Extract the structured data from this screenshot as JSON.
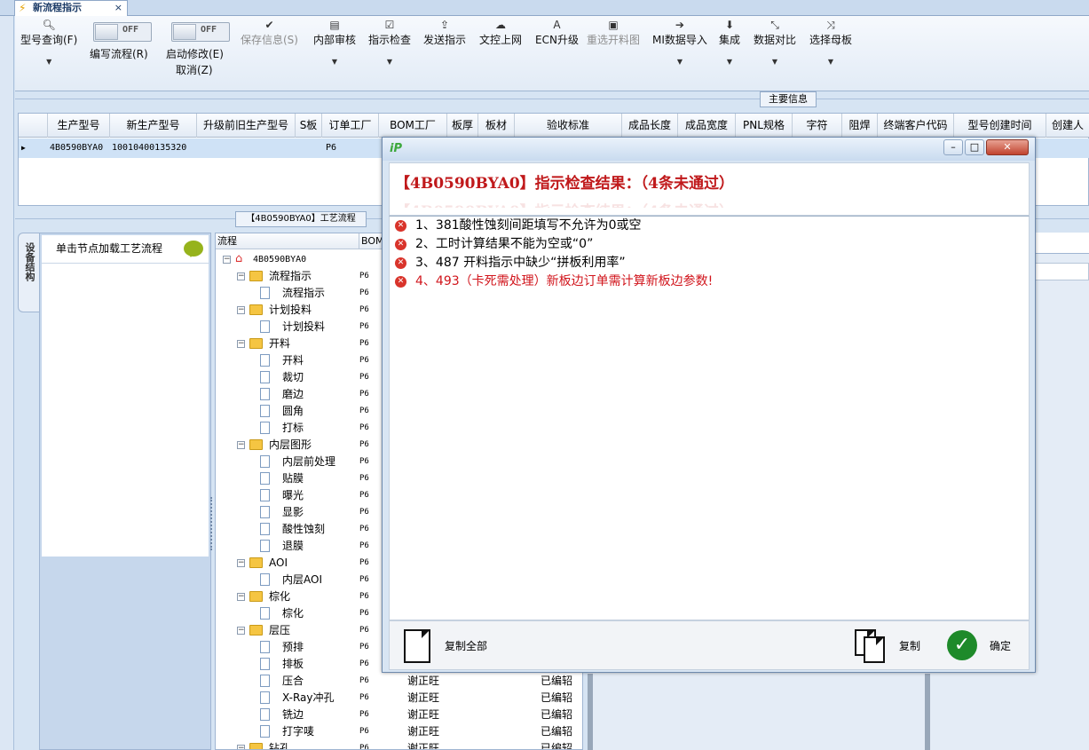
{
  "tab": {
    "title": "新流程指示",
    "close": "×"
  },
  "ribbon": {
    "model_query": "型号查询(F)",
    "write_flow": "编写流程(R)",
    "write_flow_toggle": "OFF",
    "auto_modify": "启动修改(E)",
    "auto_modify_toggle": "OFF",
    "cancel": "取消(Z)",
    "save_info": "保存信息(S)",
    "internal_review": "内部审核",
    "instr_check": "指示检查",
    "send_instr": "发送指示",
    "upload": "文控上网",
    "ecn_upgrade": "ECN升级",
    "reselect_cut": "重选开料图",
    "mi_import": "MI数据导入",
    "integrate": "集成",
    "data_compare": "数据对比",
    "select_mother": "选择母板"
  },
  "section_main": "主要信息",
  "grid": {
    "headers": [
      "生产型号",
      "新生产型号",
      "升级前旧生产型号",
      "S板",
      "订单工厂",
      "BOM工厂",
      "板厚",
      "板材",
      "验收标准",
      "成品长度",
      "成品宽度",
      "PNL规格",
      "字符",
      "阻焊",
      "终端客户代码",
      "型号创建时间",
      "创建人"
    ],
    "row": {
      "model": "4B0590BYA0",
      "new_model": "10010400135320",
      "bom": "P6"
    }
  },
  "section_flow": "【4B0590BYA0】工艺流程",
  "side": {
    "vtab": "设备结构",
    "head": "单击节点加载工艺流程"
  },
  "tree": {
    "col_flow": "流程",
    "col_bom": "BOM_",
    "rows": [
      {
        "label": "4B0590BYA0",
        "bom": "",
        "p2": "",
        "p3": ""
      },
      {
        "label": "流程指示",
        "bom": "P6",
        "p2": "",
        "p3": ""
      },
      {
        "label": "流程指示",
        "bom": "P6",
        "p2": "",
        "p3": ""
      },
      {
        "label": "计划投料",
        "bom": "P6",
        "p2": "",
        "p3": ""
      },
      {
        "label": "计划投料",
        "bom": "P6",
        "p2": "",
        "p3": ""
      },
      {
        "label": "开料",
        "bom": "P6",
        "p2": "",
        "p3": ""
      },
      {
        "label": "开料",
        "bom": "P6",
        "p2": "",
        "p3": ""
      },
      {
        "label": "裁切",
        "bom": "P6",
        "p2": "",
        "p3": ""
      },
      {
        "label": "磨边",
        "bom": "P6",
        "p2": "",
        "p3": ""
      },
      {
        "label": "圆角",
        "bom": "P6",
        "p2": "",
        "p3": ""
      },
      {
        "label": "打标",
        "bom": "P6",
        "p2": "",
        "p3": ""
      },
      {
        "label": "内层图形",
        "bom": "P6",
        "p2": "",
        "p3": ""
      },
      {
        "label": "内层前处理",
        "bom": "P6",
        "p2": "",
        "p3": ""
      },
      {
        "label": "贴膜",
        "bom": "P6",
        "p2": "",
        "p3": ""
      },
      {
        "label": "曝光",
        "bom": "P6",
        "p2": "",
        "p3": ""
      },
      {
        "label": "显影",
        "bom": "P6",
        "p2": "",
        "p3": ""
      },
      {
        "label": "酸性蚀刻",
        "bom": "P6",
        "p2": "",
        "p3": ""
      },
      {
        "label": "退膜",
        "bom": "P6",
        "p2": "",
        "p3": ""
      },
      {
        "label": "AOI",
        "bom": "P6",
        "p2": "",
        "p3": ""
      },
      {
        "label": "内层AOI",
        "bom": "P6",
        "p2": "",
        "p3": ""
      },
      {
        "label": "棕化",
        "bom": "P6",
        "p2": "",
        "p3": ""
      },
      {
        "label": "棕化",
        "bom": "P6",
        "p2": "",
        "p3": ""
      },
      {
        "label": "层压",
        "bom": "P6",
        "p2": "",
        "p3": ""
      },
      {
        "label": "预排",
        "bom": "P6",
        "p2": "",
        "p3": ""
      },
      {
        "label": "排板",
        "bom": "P6",
        "p2": "",
        "p3": ""
      },
      {
        "label": "压合",
        "bom": "P6",
        "p2": "谢正旺",
        "p3": "已编轺"
      },
      {
        "label": "X-Ray冲孔",
        "bom": "P6",
        "p2": "谢正旺",
        "p3": "已编轺"
      },
      {
        "label": "铣边",
        "bom": "P6",
        "p2": "谢正旺",
        "p3": "已编轺"
      },
      {
        "label": "打字唛",
        "bom": "P6",
        "p2": "谢正旺",
        "p3": "已编轺"
      },
      {
        "label": "钻孔",
        "bom": "P6",
        "p2": "谢正旺",
        "p3": "已编轺"
      }
    ]
  },
  "dialog": {
    "logo": "iP",
    "title": "【4B0590BYA0】指示检查结果：（4条未通过）",
    "items": [
      "1、381酸性蚀刻间距填写不允许为0或空",
      "2、工时计算结果不能为空或“0”",
      "3、487 开料指示中缺少“拼板利用率”",
      "4、493（卡死需处理）新板边订单需计算新板边参数!"
    ],
    "copy_all": "复制全部",
    "copy": "复制",
    "ok": "确定"
  }
}
